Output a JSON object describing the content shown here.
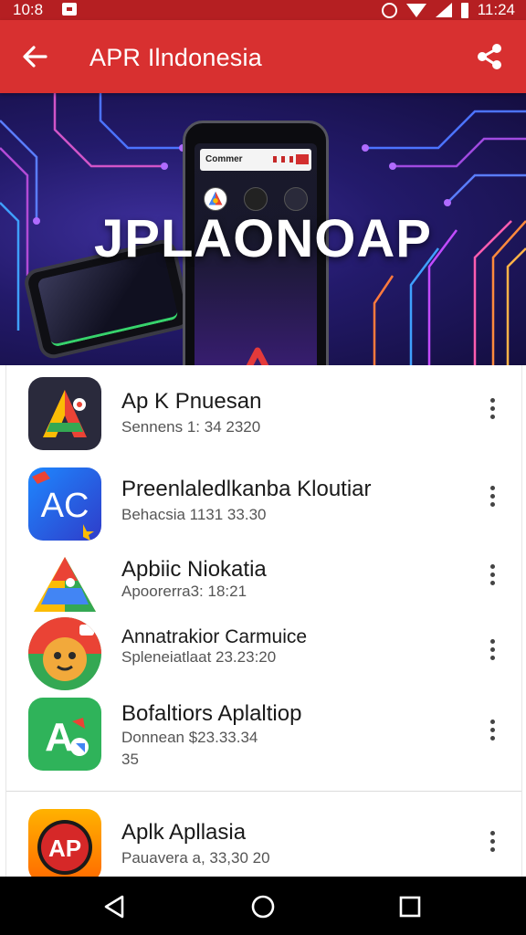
{
  "status_bar": {
    "time_left": "10:8",
    "time_right": "11:24"
  },
  "app_bar": {
    "title": "APR Ilndonesia",
    "back_icon": "arrow-left-icon",
    "share_icon": "share-icon"
  },
  "hero": {
    "headline": "JPLAONOAP",
    "phone_header": "Commer",
    "colors": {
      "background": "#231a6b",
      "accent_red": "#d83030"
    }
  },
  "apps": [
    {
      "name": "Ap K Pnuesan",
      "subtitle": "Sennens 1: 34 2320",
      "icon": "app-icon-a-colorful"
    },
    {
      "name": "Preenlaledlkanba Kloutiar",
      "subtitle": "Behacsia 1131 33.30",
      "icon": "app-icon-ac-blue",
      "icon_text": "AC"
    },
    {
      "name": "Apbiic Niokatia",
      "subtitle": "Apoorerra3: 18:21",
      "icon": "app-icon-maps"
    },
    {
      "name": "Annatrakior Carmuice",
      "subtitle": "Spleneiatlaat 23.23:20",
      "icon": "app-icon-cartoon"
    },
    {
      "name": "Bofaltiors Aplaltiop",
      "subtitle": "Donnean $23.33.34",
      "subtitle_extra": "35",
      "icon": "app-icon-a-green",
      "icon_text": "A"
    },
    {
      "name": "Aplk Apllasia",
      "subtitle": "Pauavera a, 33,30 20",
      "icon": "app-icon-ap-orange",
      "icon_text": "AP"
    }
  ],
  "more_icon": "more-vert-icon",
  "nav_bar": {
    "back": "nav-back-icon",
    "home": "nav-home-icon",
    "recents": "nav-recents-icon"
  }
}
